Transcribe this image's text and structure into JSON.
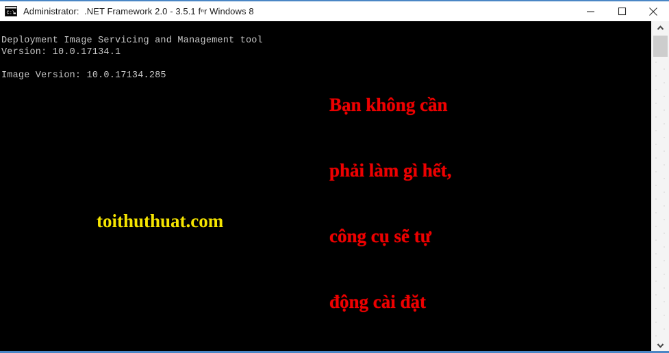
{
  "window": {
    "title": "Administrator:  .NET Framework 2.0 - 3.5.1 fⁿr Windows 8",
    "icon": "console-icon",
    "accent_color": "#4a86c5",
    "titlebar_bg": "#ffffff",
    "title_color": "#1a1a1a"
  },
  "titlebar_buttons": {
    "minimize_label": "Minimize",
    "maximize_label": "Maximize",
    "close_label": "Close"
  },
  "console": {
    "background": "#000000",
    "foreground": "#c8c8c8",
    "text": "Deployment Image Servicing and Management tool\nVersion: 10.0.17134.1\n\nImage Version: 10.0.17134.285"
  },
  "annotations": {
    "red_note": {
      "color": "#ee0000",
      "lines": [
        "Bạn không cần",
        "phải làm gì hết,",
        "công cụ sẽ tự",
        "động cài đặt"
      ]
    },
    "watermark": {
      "color": "#f5e400",
      "text": "toithuthuat.com"
    }
  },
  "scrollbar": {
    "up_arrow": "chevron-up-icon",
    "down_arrow": "chevron-down-icon",
    "track_color": "#f4f4f4",
    "thumb_color": "#cdcdcd"
  }
}
